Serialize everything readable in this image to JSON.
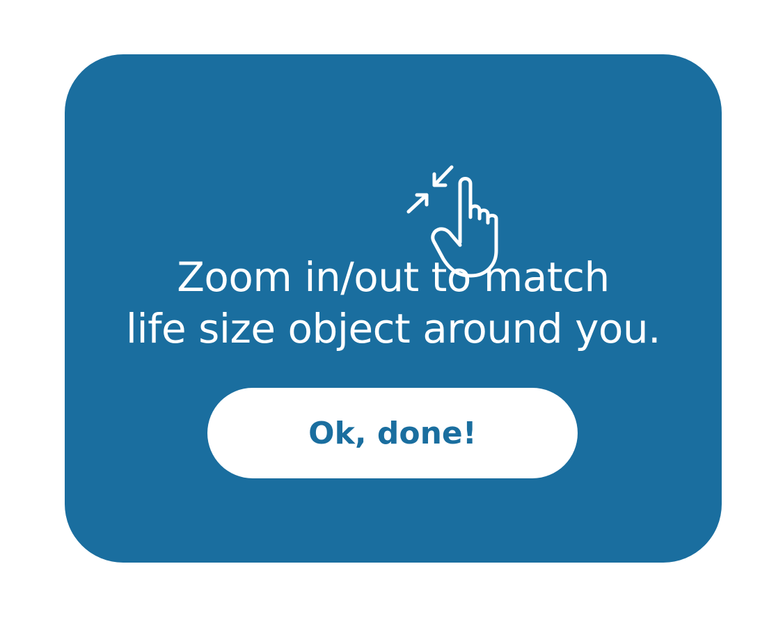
{
  "dialog": {
    "icon": "pinch-zoom-hand-icon",
    "message_line1": "Zoom in/out to match",
    "message_line2": "life size object around you.",
    "ok_label": "Ok, done!"
  },
  "colors": {
    "card_background": "#1a6e9f",
    "text": "#ffffff",
    "button_background": "#ffffff",
    "button_text": "#1a6e9f"
  }
}
